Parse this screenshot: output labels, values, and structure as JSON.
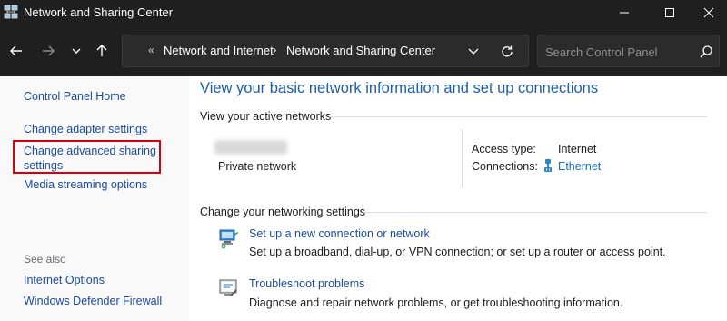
{
  "window": {
    "title": "Network and Sharing Center",
    "app_icon": "network-center-icon"
  },
  "address": {
    "breadcrumb": [
      "Network and Internet",
      "Network and Sharing Center"
    ],
    "search_placeholder": "Search Control Panel"
  },
  "sidebar": {
    "home": "Control Panel Home",
    "links": [
      "Change adapter settings",
      "Change advanced sharing settings",
      "Media streaming options"
    ],
    "see_also_heading": "See also",
    "see_also": [
      "Internet Options",
      "Windows Defender Firewall"
    ],
    "highlighted_item": "Change advanced sharing settings",
    "highlight_color": "#d9000d"
  },
  "main": {
    "heading": "View your basic network information and set up connections",
    "active_networks_label": "View your active networks",
    "network": {
      "profile": "Private network",
      "access_type_label": "Access type:",
      "access_type_value": "Internet",
      "connections_label": "Connections:",
      "connections_value": "Ethernet"
    },
    "change_settings_label": "Change your networking settings",
    "tasks": [
      {
        "icon": "new-connection-icon",
        "link": "Set up a new connection or network",
        "description": "Set up a broadband, dial-up, or VPN connection; or set up a router or access point."
      },
      {
        "icon": "troubleshoot-icon",
        "link": "Troubleshoot problems",
        "description": "Diagnose and repair network problems, or get troubleshooting information."
      }
    ]
  },
  "colors": {
    "titlebar_bg": "#1f1f1f",
    "link": "#1a4a9c",
    "heading": "#1f5da8"
  }
}
